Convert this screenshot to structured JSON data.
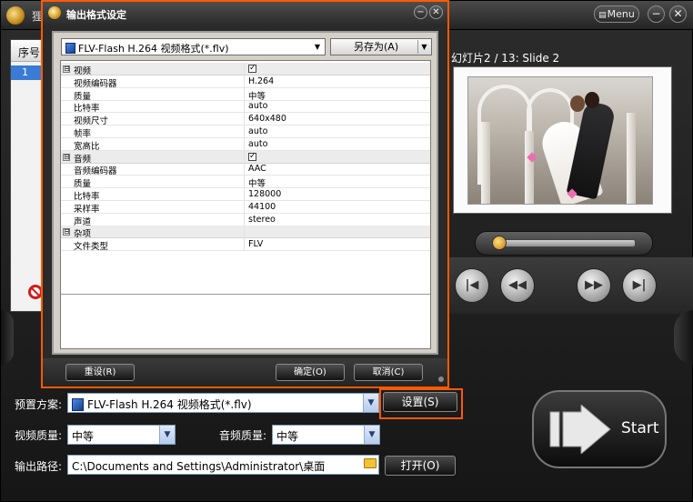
{
  "app": {
    "title_fragment": "狸",
    "menu_label": "Menu",
    "minimize_glyph": "−",
    "close_glyph": "✕",
    "slide_list": {
      "column_header": "序号",
      "rows": [
        "1"
      ]
    },
    "preview": {
      "caption": "幻灯片2 / 13: Slide 2"
    },
    "controls": {
      "first": "|◀",
      "rewind": "◀◀",
      "forward": "▶▶",
      "last": "▶|"
    },
    "settings": {
      "preset_label": "预置方案:",
      "preset_value": "FLV-Flash H.264 视频格式(*.flv)",
      "settings_button": "设置(S)",
      "video_quality_label": "视频质量:",
      "video_quality_value": "中等",
      "audio_quality_label": "音频质量:",
      "audio_quality_value": "中等",
      "output_path_label": "输出路径:",
      "output_path_value": "C:\\Documents and Settings\\Administrator\\桌面",
      "open_button": "打开(O)",
      "start_button": "Start"
    },
    "highlight_color": "#ff5a00"
  },
  "dialog": {
    "title": "输出格式设定",
    "minimize_glyph": "−",
    "close_glyph": "✕",
    "format_select": "FLV-Flash H.264 视频格式(*.flv)",
    "saveas_label": "另存为(A)",
    "properties": [
      {
        "type": "category",
        "expander": "⊟",
        "name": "视频",
        "checked": true
      },
      {
        "type": "item",
        "name": "视频编码器",
        "value": "H.264"
      },
      {
        "type": "item",
        "name": "质量",
        "value": "中等"
      },
      {
        "type": "item",
        "name": "比特率",
        "value": "auto"
      },
      {
        "type": "item",
        "name": "视频尺寸",
        "value": "640x480"
      },
      {
        "type": "item",
        "name": "帧率",
        "value": "auto"
      },
      {
        "type": "item",
        "name": "宽高比",
        "value": "auto"
      },
      {
        "type": "category",
        "expander": "⊟",
        "name": "音频",
        "checked": true
      },
      {
        "type": "item",
        "name": "音频编码器",
        "value": "AAC"
      },
      {
        "type": "item",
        "name": "质量",
        "value": "中等"
      },
      {
        "type": "item",
        "name": "比特率",
        "value": "128000"
      },
      {
        "type": "item",
        "name": "采样率",
        "value": "44100"
      },
      {
        "type": "item",
        "name": "声道",
        "value": "stereo"
      },
      {
        "type": "category",
        "expander": "⊟",
        "name": "杂项",
        "checked": false
      },
      {
        "type": "item",
        "name": "文件类型",
        "value": "FLV"
      }
    ],
    "reset_label": "重设(R)",
    "ok_label": "确定(O)",
    "cancel_label": "取消(C)"
  }
}
